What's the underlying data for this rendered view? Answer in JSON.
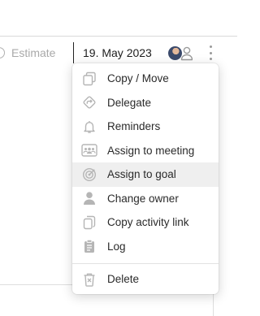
{
  "toolbar": {
    "estimate_label": "Estimate",
    "date_value": "19. May 2023"
  },
  "menu": {
    "items": [
      {
        "label": "Copy / Move",
        "icon": "copy-icon"
      },
      {
        "label": "Delegate",
        "icon": "delegate-arrow-icon"
      },
      {
        "label": "Reminders",
        "icon": "bell-icon"
      },
      {
        "label": "Assign to meeting",
        "icon": "meeting-icon"
      },
      {
        "label": "Assign to goal",
        "icon": "goal-target-icon",
        "highlighted": true
      },
      {
        "label": "Change owner",
        "icon": "person-icon"
      },
      {
        "label": "Copy activity link",
        "icon": "copy-link-icon"
      },
      {
        "label": "Log",
        "icon": "clipboard-icon"
      }
    ],
    "delete_label": "Delete",
    "delete_icon": "trash-icon"
  },
  "colors": {
    "icon_gray": "#b5b5b5",
    "highlight_bg": "#efefef",
    "text": "#2a2a2a",
    "muted_text": "#a9a9a9"
  }
}
